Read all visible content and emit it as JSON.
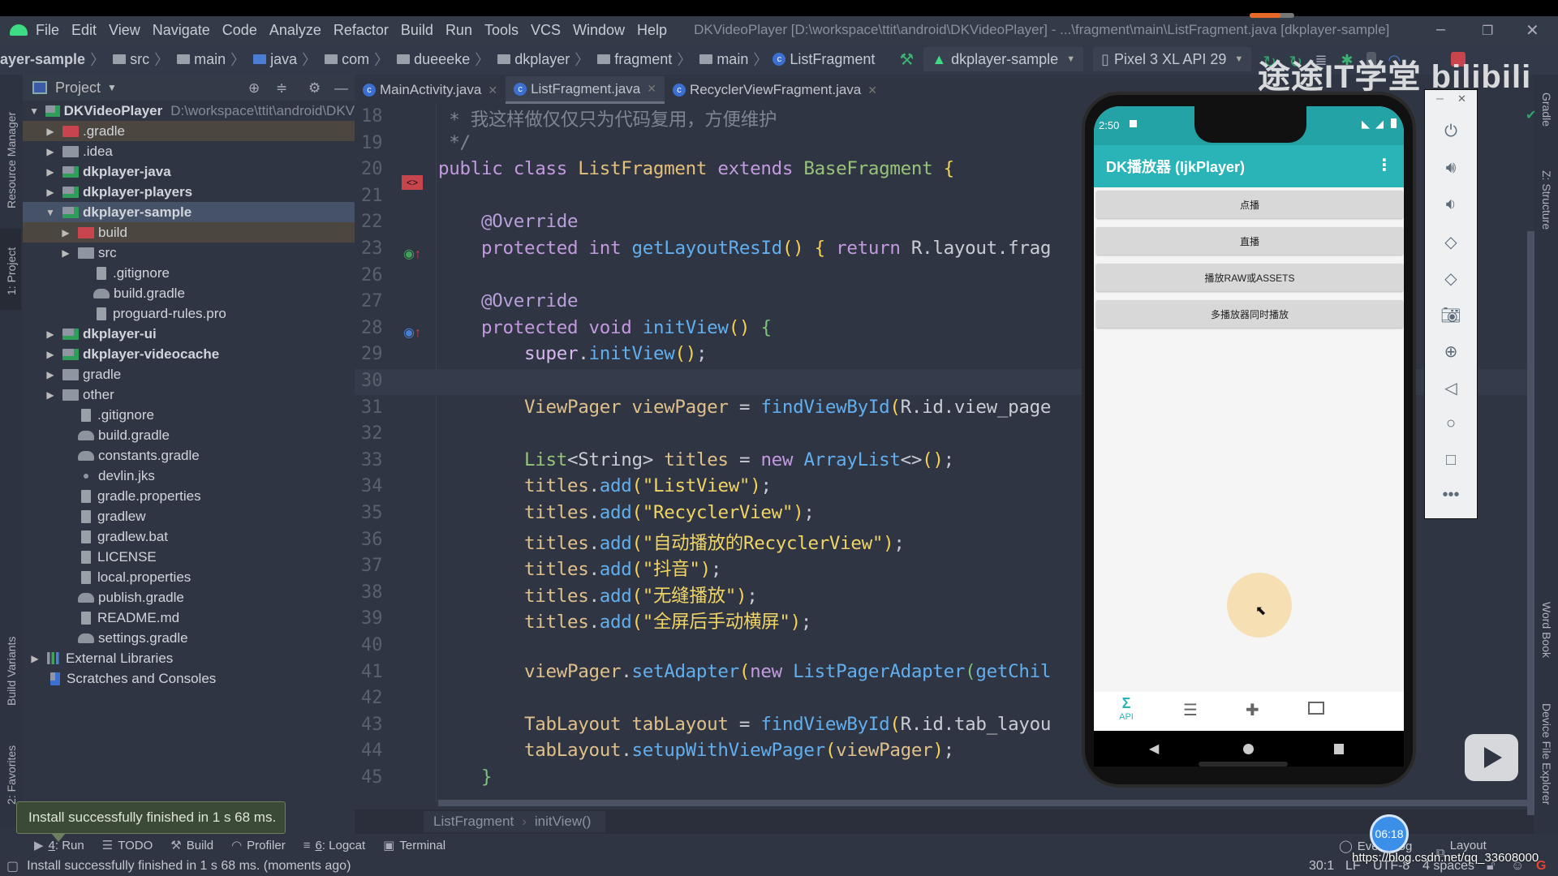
{
  "menubar": {
    "items": [
      "File",
      "Edit",
      "View",
      "Navigate",
      "Code",
      "Analyze",
      "Refactor",
      "Build",
      "Run",
      "Tools",
      "VCS",
      "Window",
      "Help"
    ],
    "window_title": "DKVideoPlayer [D:\\workspace\\ttit\\android\\DKVideoPlayer] - ...\\fragment\\main\\ListFragment.java [dkplayer-sample]"
  },
  "navbar": {
    "breadcrumbs": [
      "ayer-sample",
      "src",
      "main",
      "java",
      "com",
      "dueeeke",
      "dkplayer",
      "fragment",
      "main"
    ],
    "current_class": "ListFragment",
    "run_config": "dkplayer-sample",
    "device": "Pixel 3 XL API 29"
  },
  "left_stripe": [
    "Resource Manager",
    "1: Project",
    "Build Variants",
    "2: Favorites"
  ],
  "right_stripe": [
    "Gradle",
    "Z: Structure",
    "Word Book",
    "Device File Explorer"
  ],
  "project": {
    "title": "Project",
    "tree": [
      {
        "label": "DKVideoPlayer",
        "path": "D:\\workspace\\ttit\\android\\DKV",
        "indent": 0,
        "twisty": "▼",
        "icon": "mod",
        "bold": true
      },
      {
        "label": ".gradle",
        "indent": 1,
        "twisty": "▶",
        "icon": "red",
        "hl": true
      },
      {
        "label": ".idea",
        "indent": 1,
        "twisty": "▶",
        "icon": "folder"
      },
      {
        "label": "dkplayer-java",
        "indent": 1,
        "twisty": "▶",
        "icon": "mod",
        "bold": true
      },
      {
        "label": "dkplayer-players",
        "indent": 1,
        "twisty": "▶",
        "icon": "mod",
        "bold": true
      },
      {
        "label": "dkplayer-sample",
        "indent": 1,
        "twisty": "▼",
        "icon": "mod",
        "bold": true,
        "sel": true
      },
      {
        "label": "build",
        "indent": 2,
        "twisty": "▶",
        "icon": "red",
        "hl": true
      },
      {
        "label": "src",
        "indent": 2,
        "twisty": "▶",
        "icon": "folder"
      },
      {
        "label": ".gitignore",
        "indent": 3,
        "icon": "file"
      },
      {
        "label": "build.gradle",
        "indent": 3,
        "icon": "gradle"
      },
      {
        "label": "proguard-rules.pro",
        "indent": 3,
        "icon": "file"
      },
      {
        "label": "dkplayer-ui",
        "indent": 1,
        "twisty": "▶",
        "icon": "mod",
        "bold": true
      },
      {
        "label": "dkplayer-videocache",
        "indent": 1,
        "twisty": "▶",
        "icon": "mod",
        "bold": true
      },
      {
        "label": "gradle",
        "indent": 1,
        "twisty": "▶",
        "icon": "folder"
      },
      {
        "label": "other",
        "indent": 1,
        "twisty": "▶",
        "icon": "folder"
      },
      {
        "label": ".gitignore",
        "indent": 2,
        "icon": "file"
      },
      {
        "label": "build.gradle",
        "indent": 2,
        "icon": "gradle"
      },
      {
        "label": "constants.gradle",
        "indent": 2,
        "icon": "gradle"
      },
      {
        "label": "devlin.jks",
        "indent": 2,
        "icon": "dot"
      },
      {
        "label": "gradle.properties",
        "indent": 2,
        "icon": "file"
      },
      {
        "label": "gradlew",
        "indent": 2,
        "icon": "file"
      },
      {
        "label": "gradlew.bat",
        "indent": 2,
        "icon": "file"
      },
      {
        "label": "LICENSE",
        "indent": 2,
        "icon": "file"
      },
      {
        "label": "local.properties",
        "indent": 2,
        "icon": "file"
      },
      {
        "label": "publish.gradle",
        "indent": 2,
        "icon": "gradle"
      },
      {
        "label": "README.md",
        "indent": 2,
        "icon": "file"
      },
      {
        "label": "settings.gradle",
        "indent": 2,
        "icon": "gradle"
      },
      {
        "label": "External Libraries",
        "indent": 0,
        "twisty": "▶",
        "icon": "lib"
      },
      {
        "label": "Scratches and Consoles",
        "indent": 0,
        "icon": "scratch"
      }
    ]
  },
  "editor": {
    "tabs": [
      {
        "label": "MainActivity.java",
        "active": false
      },
      {
        "label": "ListFragment.java",
        "active": true
      },
      {
        "label": "RecyclerViewFragment.java",
        "active": false
      }
    ],
    "current_line": "30",
    "lines": [
      {
        "n": "18",
        "html": "<span class='cm'> * 我这样做仅仅只为代码复用，方便维护</span>"
      },
      {
        "n": "19",
        "html": "<span class='cm'> */</span>"
      },
      {
        "n": "20",
        "html": "<span class='k'>public class </span><span class='t'>ListFragment </span><span class='k'>extends </span><span class='g'>BaseFragment </span><span class='p'>{</span>"
      },
      {
        "n": "21",
        "html": ""
      },
      {
        "n": "22",
        "html": "    <span class='a'>@Override</span>"
      },
      {
        "n": "23",
        "html": "    <span class='k'>protected int </span><span class='f'>getLayoutResId</span><span class='p'>() { </span><span class='k'>return </span><span>R.layout.frag</span>"
      },
      {
        "n": "26",
        "html": ""
      },
      {
        "n": "27",
        "html": "    <span class='a'>@Override</span>"
      },
      {
        "n": "28",
        "html": "    <span class='k'>protected void </span><span class='f'>initView</span><span class='p'>() </span><span class='pg'>{</span>"
      },
      {
        "n": "29",
        "html": "        <span class='pb'>super</span>.<span class='f'>initView</span><span class='p'>()</span>;"
      },
      {
        "n": "30",
        "html": ""
      },
      {
        "n": "31",
        "html": "        <span class='n'>ViewPager viewPager </span>= <span class='f'>findViewById</span><span class='p'>(</span>R.id.view_page"
      },
      {
        "n": "32",
        "html": ""
      },
      {
        "n": "33",
        "html": "        <span class='g'>List</span>&lt;String&gt; <span class='n'>titles </span>= <span class='k'>new </span><span class='f'>ArrayList</span>&lt;&gt;<span class='p'>()</span>;"
      },
      {
        "n": "34",
        "html": "        <span class='n'>titles</span>.<span class='f'>add</span><span class='p'>(</span><span class='s'>\"ListView\"</span><span class='p'>)</span>;"
      },
      {
        "n": "35",
        "html": "        <span class='n'>titles</span>.<span class='f'>add</span><span class='p'>(</span><span class='s'>\"RecyclerView\"</span><span class='p'>)</span>;"
      },
      {
        "n": "36",
        "html": "        <span class='n'>titles</span>.<span class='f'>add</span><span class='p'>(</span><span class='s'>\"自动播放的RecyclerView\"</span><span class='p'>)</span>;"
      },
      {
        "n": "37",
        "html": "        <span class='n'>titles</span>.<span class='f'>add</span><span class='p'>(</span><span class='s'>\"抖音\"</span><span class='p'>)</span>;"
      },
      {
        "n": "38",
        "html": "        <span class='n'>titles</span>.<span class='f'>add</span><span class='p'>(</span><span class='s'>\"无缝播放\"</span><span class='p'>)</span>;"
      },
      {
        "n": "39",
        "html": "        <span class='n'>titles</span>.<span class='f'>add</span><span class='p'>(</span><span class='s'>\"全屏后手动横屏\"</span><span class='p'>)</span>;"
      },
      {
        "n": "40",
        "html": ""
      },
      {
        "n": "41",
        "html": "        <span class='n'>viewPager</span>.<span class='f'>setAdapter</span><span class='p'>(</span><span class='k'>new </span><span class='f'>ListPagerAdapter</span><span class='pg'>(</span><span class='f'>getChil</span>"
      },
      {
        "n": "42",
        "html": ""
      },
      {
        "n": "43",
        "html": "        <span class='n'>TabLayout tabLayout </span>= <span class='f'>findViewById</span><span class='p'>(</span>R.id.tab_layou"
      },
      {
        "n": "44",
        "html": "        <span class='n'>tabLayout</span>.<span class='f'>setupWithViewPager</span><span class='p'>(</span><span class='n'>viewPager</span><span class='p'>)</span>;"
      },
      {
        "n": "45",
        "html": "    <span class='pg'>}</span>"
      }
    ],
    "breadcrumb": [
      "ListFragment",
      "initView()"
    ]
  },
  "toast": "Install successfully finished in 1 s 68 ms.",
  "toolwindows": [
    {
      "num": "4",
      "label": ": Run",
      "icon": "▶"
    },
    {
      "num": "",
      "label": "TODO",
      "icon": "☰"
    },
    {
      "num": "",
      "label": "Build",
      "icon": "⚒"
    },
    {
      "num": "",
      "label": "Profiler",
      "icon": "◠"
    },
    {
      "num": "6",
      "label": ": Logcat",
      "icon": "≡"
    },
    {
      "num": "",
      "label": "Terminal",
      "icon": "▣"
    }
  ],
  "toolwindows_right": [
    "Event Log",
    "Layout Inspector"
  ],
  "status": {
    "message": "Install successfully finished in 1 s 68 ms. (moments ago)",
    "position": "30:1",
    "line_sep": "LF",
    "encoding": "UTF-8",
    "indent": "4 spaces"
  },
  "phone": {
    "time": "2:50",
    "app_title": "DK播放器 (IjkPlayer)",
    "buttons": [
      "点播",
      "直播",
      "播放RAW或ASSETS",
      "多播放器同时播放"
    ],
    "bottom_nav": [
      {
        "label": "API",
        "icon": "sigma-icon",
        "active": true
      },
      {
        "label": "",
        "icon": "list-icon",
        "active": false
      },
      {
        "label": "",
        "icon": "puzzle-icon",
        "active": false
      },
      {
        "label": "",
        "icon": "pip-icon",
        "active": false
      }
    ],
    "accent": "#2ab4b7"
  },
  "emulator_toolbar": [
    "power",
    "volume-up",
    "volume-down",
    "rotate-left",
    "rotate-right",
    "screenshot",
    "zoom",
    "back",
    "home",
    "overview",
    "more"
  ],
  "overlay": {
    "watermark": "途途IT学堂 bilibili",
    "timer": "06:18",
    "url": "https://blog.csdn.net/qq_33608000"
  }
}
